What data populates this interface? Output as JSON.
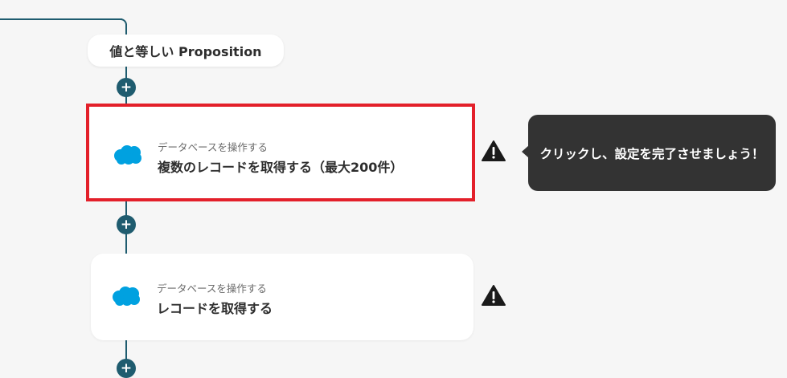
{
  "flow": {
    "condition_label": "値と等しい Proposition",
    "add_symbol": "+"
  },
  "operations": [
    {
      "icon": "salesforce-cloud-icon",
      "subtitle": "データベースを操作する",
      "title": "複数のレコードを取得する（最大200件）",
      "selected": true,
      "warning": true
    },
    {
      "icon": "salesforce-cloud-icon",
      "subtitle": "データベースを操作する",
      "title": "レコードを取得する",
      "selected": false,
      "warning": true
    }
  ],
  "tooltip": {
    "text": "クリックし、設定を完了させましょう！"
  },
  "colors": {
    "connector": "#1f5c6f",
    "selection_border": "#e3202a",
    "salesforce_blue": "#00a1e0",
    "tooltip_bg": "#333333",
    "warning": "#1a1a1a"
  }
}
